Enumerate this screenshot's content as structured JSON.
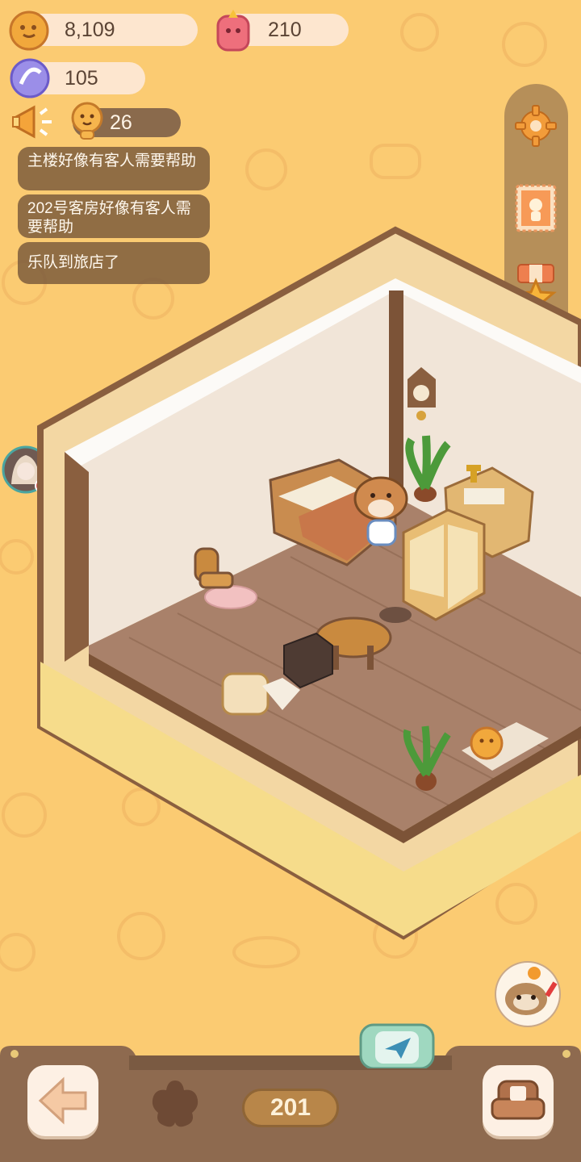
{
  "resources": {
    "cookies": "8,109",
    "gems": "210",
    "energy": "105",
    "guests": "26"
  },
  "notices": [
    "主楼好像有客人需要帮助",
    "202号客房好像有客人需要帮助",
    "乐队到旅店了"
  ],
  "room": {
    "number": "201"
  },
  "colors": {
    "background": "#fbcb72",
    "pill": "#fde6cf",
    "notice_bg": "#78583a",
    "wall": "#f1e5d8",
    "floor": "#a9816a",
    "frame": "#8a5f3f"
  },
  "icons": {
    "cookies": "cookie-icon",
    "gems": "pink-gem-icon",
    "energy": "energy-orb-icon",
    "guests": "guest-face-icon",
    "announcement": "megaphone-icon",
    "settings": "gear-icon",
    "album": "stamp-icon",
    "rewards": "medal-star-icon",
    "inventory": "backpack-icon",
    "back": "left-arrow-icon",
    "rank": "star-shape-icon",
    "mail": "paper-plane-icon",
    "furniture": "armchair-icon",
    "chat": "raccoon-chat-icon"
  }
}
